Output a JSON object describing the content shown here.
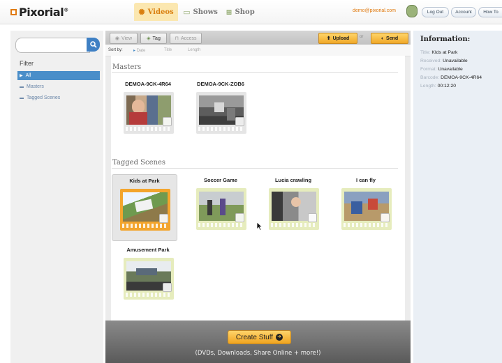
{
  "header": {
    "logo": "Pixorial",
    "logo_mark": "®",
    "tabs": [
      {
        "label": "Videos",
        "active": true,
        "icon": "film-icon"
      },
      {
        "label": "Shows",
        "active": false,
        "icon": "screen-icon"
      },
      {
        "label": "Shop",
        "active": false,
        "icon": "cart-icon"
      }
    ],
    "email": "demo@pixorial.com",
    "buttons": [
      "Log Out",
      "Account",
      "How To"
    ]
  },
  "sidebar": {
    "search_placeholder": "",
    "filter_title": "Filter",
    "items": [
      {
        "label": "All",
        "selected": true
      },
      {
        "label": "Masters",
        "selected": false
      },
      {
        "label": "Tagged Scenes",
        "selected": false
      }
    ]
  },
  "toolbar": {
    "view": "View",
    "tag": "Tag",
    "access": "Access",
    "upload": "Upload",
    "or": "or",
    "send": "Send"
  },
  "sort": {
    "label": "Sort by:",
    "options": [
      "Date",
      "Title",
      "Length"
    ]
  },
  "masters": {
    "title": "Masters",
    "items": [
      {
        "label": "DEMOA-9CK-4R64"
      },
      {
        "label": "DEMOA-9CK-ZOB6"
      }
    ]
  },
  "tagged": {
    "title": "Tagged Scenes",
    "items": [
      {
        "label": "Kids at Park",
        "selected": true
      },
      {
        "label": "Soccer Game"
      },
      {
        "label": "Lucia crawling"
      },
      {
        "label": "I can fly"
      },
      {
        "label": "Amusement Park"
      }
    ]
  },
  "create": {
    "label": "Create Stuff",
    "sub": "(DVDs, Downloads, Share Online + more!)"
  },
  "info": {
    "title": "Information:",
    "rows": [
      {
        "key": "Title:",
        "value": "KIds at Park"
      },
      {
        "key": "Received:",
        "value": "Unavailable"
      },
      {
        "key": "Format:",
        "value": "Unavailable"
      },
      {
        "key": "Barcode:",
        "value": "DEMOA-9CK-4R64"
      },
      {
        "key": "Length:",
        "value": "00:12:20"
      }
    ]
  },
  "colors": {
    "accent": "#f0a420",
    "selected_blue": "#4a8ec9",
    "search_blue": "#3f80c4"
  }
}
